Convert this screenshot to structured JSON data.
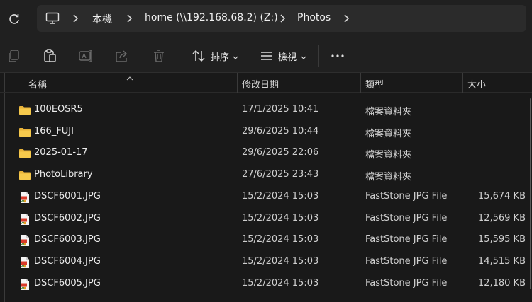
{
  "address_bar": {
    "crumbs": [
      "本機",
      "home (\\\\192.168.68.2) (Z:)",
      "Photos"
    ],
    "icons": {
      "refresh": "refresh-icon",
      "location": "computer-icon",
      "separator": "chevron-right-icon"
    }
  },
  "toolbar": {
    "copy_icon": "copy-icon",
    "paste_icon": "paste-icon",
    "rename_icon": "rename-icon",
    "share_icon": "share-icon",
    "delete_icon": "delete-icon",
    "sort_label": "排序",
    "view_label": "檢視",
    "more_icon": "more-icon"
  },
  "columns": {
    "name": "名稱",
    "date": "修改日期",
    "type": "類型",
    "size": "大小"
  },
  "files": [
    {
      "kind": "folder",
      "name": "100EOSR5",
      "date": "17/1/2025 10:41",
      "type": "檔案資料夾",
      "size": ""
    },
    {
      "kind": "folder",
      "name": "166_FUJI",
      "date": "29/6/2025 10:44",
      "type": "檔案資料夾",
      "size": ""
    },
    {
      "kind": "folder",
      "name": "2025-01-17",
      "date": "29/6/2025 22:06",
      "type": "檔案資料夾",
      "size": ""
    },
    {
      "kind": "folder",
      "name": "PhotoLibrary",
      "date": "27/6/2025 23:43",
      "type": "檔案資料夾",
      "size": ""
    },
    {
      "kind": "jpg",
      "name": "DSCF6001.JPG",
      "date": "15/2/2024 15:03",
      "type": "FastStone JPG File",
      "size": "15,674 KB"
    },
    {
      "kind": "jpg",
      "name": "DSCF6002.JPG",
      "date": "15/2/2024 15:03",
      "type": "FastStone JPG File",
      "size": "12,569 KB"
    },
    {
      "kind": "jpg",
      "name": "DSCF6003.JPG",
      "date": "15/2/2024 15:03",
      "type": "FastStone JPG File",
      "size": "15,595 KB"
    },
    {
      "kind": "jpg",
      "name": "DSCF6004.JPG",
      "date": "15/2/2024 15:03",
      "type": "FastStone JPG File",
      "size": "14,515 KB"
    },
    {
      "kind": "jpg",
      "name": "DSCF6005.JPG",
      "date": "15/2/2024 15:03",
      "type": "FastStone JPG File",
      "size": "12,180 KB"
    }
  ],
  "colors": {
    "background": "#191919",
    "chrome": "#202020",
    "address_box": "#2b2b2b",
    "folder": "#f4c542",
    "jpg_badge": "#d93a2b"
  }
}
